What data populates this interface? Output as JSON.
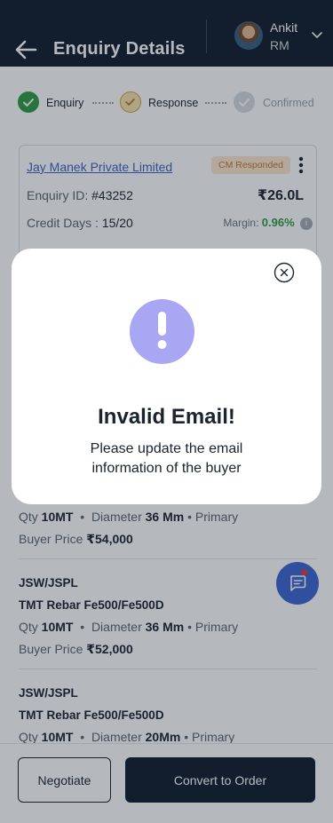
{
  "header": {
    "title": "Enquiry Details",
    "user_name": "Ankit",
    "user_role": "RM"
  },
  "stepper": [
    {
      "label": "Enquiry",
      "state": "done"
    },
    {
      "label": "Response",
      "state": "current"
    },
    {
      "label": "Confirmed",
      "state": "pending"
    }
  ],
  "card": {
    "company": "Jay Manek Private Limited",
    "status_badge": "CM Responded",
    "enquiry_id_label": "Enquiry ID:",
    "enquiry_id": "#43252",
    "amount": "₹26.0L",
    "credit_days_label": "Credit Days :",
    "credit_days": "15/20",
    "margin_label": "Margin:",
    "margin": "0.96%"
  },
  "products": [
    {
      "qty_label": "Qty",
      "qty": "10MT",
      "diameter_label": "Diameter",
      "diameter": "36 Mm",
      "grade": "Primary",
      "price_label": "Buyer Price",
      "price": "₹54,000"
    },
    {
      "brand": "JSW/JSPL",
      "name": "TMT Rebar Fe500/Fe500D",
      "qty_label": "Qty",
      "qty": "10MT",
      "diameter_label": "Diameter",
      "diameter": "36 Mm",
      "grade": "Primary",
      "price_label": "Buyer Price",
      "price": "₹52,000"
    },
    {
      "brand": "JSW/JSPL",
      "name": "TMT Rebar Fe500/Fe500D",
      "qty_label": "Qty",
      "qty": "10MT",
      "diameter_label": "Diameter",
      "diameter": "20Mm",
      "grade": "Primary"
    }
  ],
  "actions": {
    "negotiate": "Negotiate",
    "convert": "Convert to Order"
  },
  "modal": {
    "title": "Invalid Email!",
    "message": "Please update the email information of the buyer",
    "icon": "exclamation-icon"
  },
  "colors": {
    "header_bg": "#0f1d2e",
    "accent_green": "#2e9b48",
    "link_blue": "#3d62c8",
    "badge_bg": "#fde8cf",
    "alert_purple": "#a9a6f4",
    "fab_blue": "#3b66d4"
  }
}
